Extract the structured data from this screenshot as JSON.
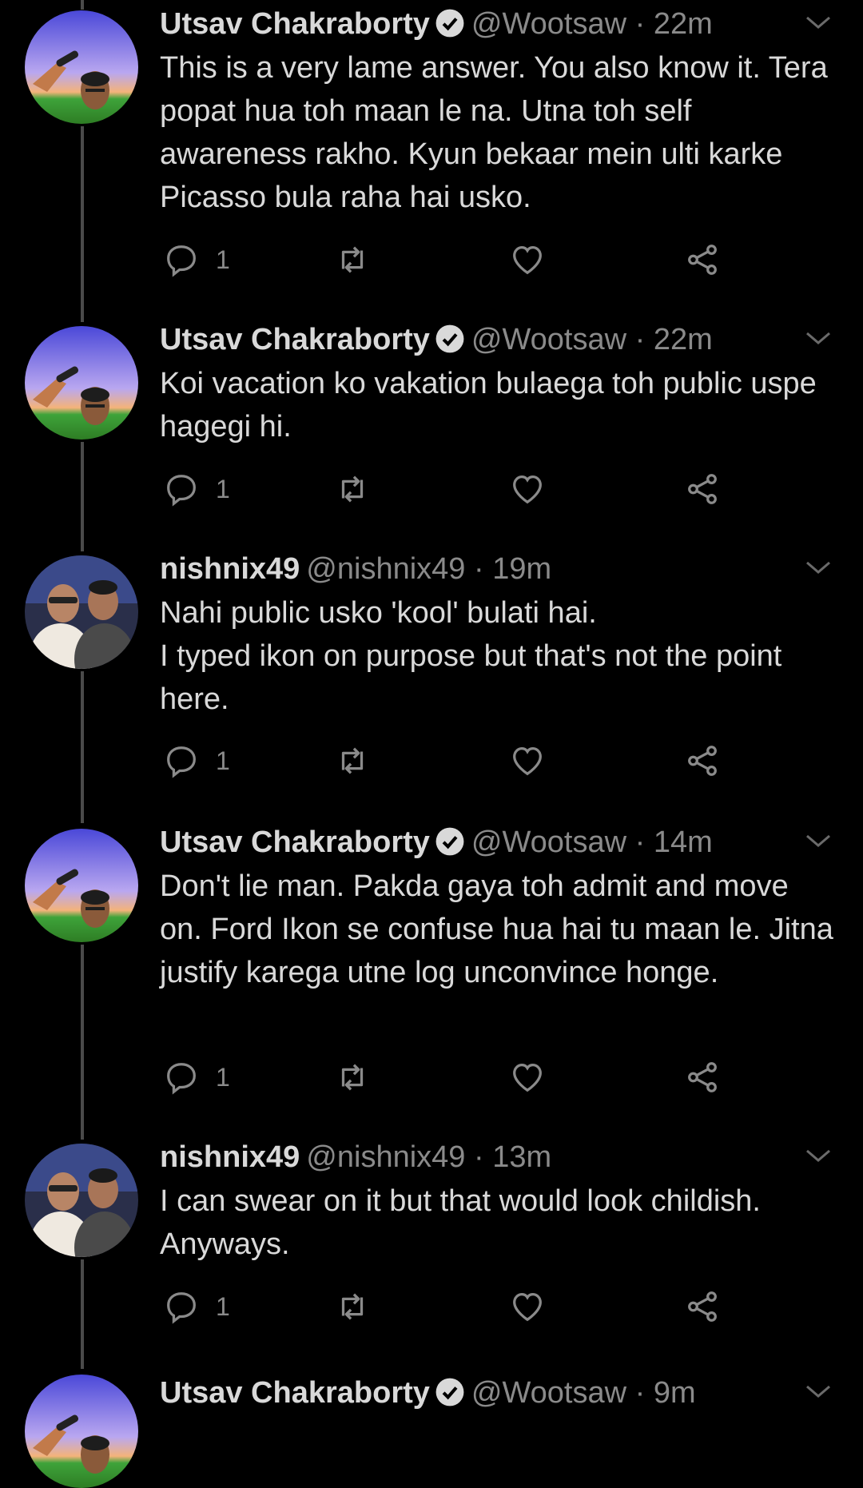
{
  "tweets": [
    {
      "name": "Utsav Chakraborty",
      "verified": true,
      "handle": "@Wootsaw · 22m",
      "text": "This is a very lame answer. You also know it. Tera popat hua toh maan le na. Utna toh self awareness rakho. Kyun bekaar mein ulti karke Picasso bula raha hai usko.",
      "replies": "1",
      "avatar": "utsav"
    },
    {
      "name": "Utsav Chakraborty",
      "verified": true,
      "handle": "@Wootsaw · 22m",
      "text": "Koi vacation ko vakation bulaega toh public uspe hagegi hi.",
      "replies": "1",
      "avatar": "utsav"
    },
    {
      "name": "nishnix49",
      "verified": false,
      "handle": "@nishnix49 · 19m",
      "text": "Nahi public usko 'kool' bulati hai.\nI typed ikon on purpose but that's not the point here.",
      "replies": "1",
      "avatar": "nishnix"
    },
    {
      "name": "Utsav Chakraborty",
      "verified": true,
      "handle": "@Wootsaw · 14m",
      "text": "Don't lie man. Pakda gaya toh admit and move on. Ford Ikon se confuse hua hai tu maan le. Jitna justify karega utne log unconvince honge.",
      "replies": "1",
      "avatar": "utsav"
    },
    {
      "name": "nishnix49",
      "verified": false,
      "handle": "@nishnix49 · 13m",
      "text": "I can swear on it but that would look childish. Anyways.",
      "replies": "1",
      "avatar": "nishnix"
    },
    {
      "name": "Utsav Chakraborty",
      "verified": true,
      "handle": "@Wootsaw · 9m",
      "text": "",
      "replies": "",
      "avatar": "utsav"
    }
  ],
  "icons": {
    "reply": "reply-icon",
    "retweet": "retweet-icon",
    "like": "heart-icon",
    "share": "share-icon",
    "caret": "chevron-down-icon",
    "verified": "verified-badge-icon"
  },
  "colors": {
    "background": "#000000",
    "text": "#d9d9d9",
    "muted": "#8a8a8a",
    "thread_line": "#4a4a4a"
  }
}
